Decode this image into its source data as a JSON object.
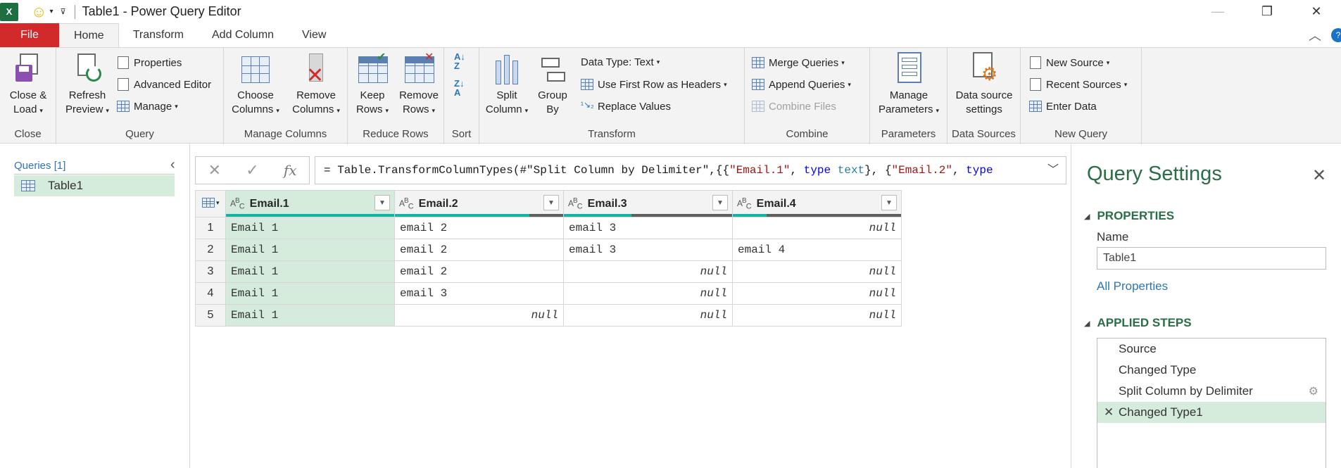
{
  "window": {
    "title": "Table1 - Power Query Editor",
    "app_icon": "excel-icon"
  },
  "tabs": [
    "File",
    "Home",
    "Transform",
    "Add Column",
    "View"
  ],
  "ribbon": {
    "close": {
      "close_load": [
        "Close &",
        "Load"
      ],
      "label": "Close"
    },
    "query": {
      "refresh": [
        "Refresh",
        "Preview"
      ],
      "properties": "Properties",
      "advanced_editor": "Advanced Editor",
      "manage": "Manage",
      "label": "Query"
    },
    "manage_columns": {
      "choose": [
        "Choose",
        "Columns"
      ],
      "remove": [
        "Remove",
        "Columns"
      ],
      "label": "Manage Columns"
    },
    "reduce_rows": {
      "keep": [
        "Keep",
        "Rows"
      ],
      "remove": [
        "Remove",
        "Rows"
      ],
      "label": "Reduce Rows"
    },
    "sort": {
      "label": "Sort"
    },
    "transform": {
      "split": [
        "Split",
        "Column"
      ],
      "group": [
        "Group",
        "By"
      ],
      "data_type": "Data Type: Text",
      "first_row": "Use First Row as Headers",
      "replace": "Replace Values",
      "label": "Transform"
    },
    "combine": {
      "merge": "Merge Queries",
      "append": "Append Queries",
      "combine_files": "Combine Files",
      "label": "Combine"
    },
    "parameters": {
      "manage": [
        "Manage",
        "Parameters"
      ],
      "label": "Parameters"
    },
    "data_sources": {
      "settings": [
        "Data source",
        "settings"
      ],
      "label": "Data Sources"
    },
    "new_query": {
      "new_source": "New Source",
      "recent_sources": "Recent Sources",
      "enter_data": "Enter Data",
      "label": "New Query"
    }
  },
  "queries": {
    "header": "Queries [1]",
    "items": [
      "Table1"
    ]
  },
  "formula": {
    "text": "= Table.TransformColumnTypes(#\"Split Column by Delimiter\",{{\"Email.1\", type text}, {\"Email.2\", type"
  },
  "grid": {
    "columns": [
      {
        "name": "Email.1",
        "type_icon": "ABC",
        "valid_fraction": 1.0
      },
      {
        "name": "Email.2",
        "type_icon": "ABC",
        "valid_fraction": 0.8
      },
      {
        "name": "Email.3",
        "type_icon": "ABC",
        "valid_fraction": 0.4
      },
      {
        "name": "Email.4",
        "type_icon": "ABC",
        "valid_fraction": 0.2
      }
    ],
    "rows": [
      [
        "1",
        "Email 1",
        "email 2",
        "email 3",
        "null"
      ],
      [
        "2",
        "Email 1",
        "email 2",
        "email 3",
        "email 4"
      ],
      [
        "3",
        "Email 1",
        "email 2",
        "null",
        "null"
      ],
      [
        "4",
        "Email 1",
        "email 3",
        "null",
        "null"
      ],
      [
        "5",
        "Email 1",
        "null",
        "null",
        "null"
      ]
    ]
  },
  "settings": {
    "title": "Query Settings",
    "properties_header": "PROPERTIES",
    "name_label": "Name",
    "name_value": "Table1",
    "all_properties": "All Properties",
    "steps_header": "APPLIED STEPS",
    "steps": [
      "Source",
      "Changed Type",
      "Split Column by Delimiter",
      "Changed Type1"
    ]
  },
  "colors": {
    "accent_green": "#2a6e47",
    "selection": "#d5ecdd",
    "file_tab": "#d22a2a",
    "valid_bar": "#16b3a2",
    "link_blue": "#2e75b6"
  }
}
